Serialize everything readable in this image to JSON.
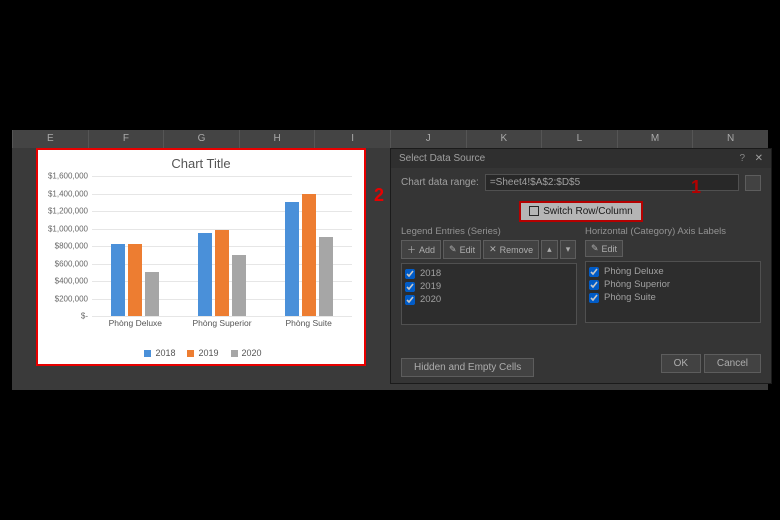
{
  "columns": [
    "E",
    "F",
    "G",
    "H",
    "I",
    "J",
    "K",
    "L",
    "M",
    "N"
  ],
  "dialog": {
    "title": "Select Data Source",
    "range_label": "Chart data range:",
    "range_value": "=Sheet4!$A$2:$D$5",
    "switch_label": "Switch Row/Column",
    "series_head": "Legend Entries (Series)",
    "axis_head": "Horizontal (Category) Axis Labels",
    "add_label": "Add",
    "edit_label": "Edit",
    "remove_label": "Remove",
    "edit2_label": "Edit",
    "series_items": [
      "2018",
      "2019",
      "2020"
    ],
    "axis_items": [
      "Phòng Deluxe",
      "Phòng Superior",
      "Phòng Suite"
    ],
    "hidden_label": "Hidden and Empty Cells",
    "ok_label": "OK",
    "cancel_label": "Cancel"
  },
  "callouts": {
    "one": "1",
    "two": "2"
  },
  "chart_data": {
    "type": "bar",
    "title": "Chart Title",
    "categories": [
      "Phòng Deluxe",
      "Phòng Superior",
      "Phòng Suite"
    ],
    "series": [
      {
        "name": "2018",
        "color": "#4a90d9",
        "values": [
          820000,
          950000,
          1300000
        ]
      },
      {
        "name": "2019",
        "color": "#ed7d31",
        "values": [
          820000,
          980000,
          1400000
        ]
      },
      {
        "name": "2020",
        "color": "#a6a6a6",
        "values": [
          500000,
          700000,
          900000
        ]
      }
    ],
    "ylim": [
      0,
      1600000
    ],
    "yticks": [
      "$1,600,000",
      "$1,400,000",
      "$1,200,000",
      "$1,000,000",
      "$800,000",
      "$600,000",
      "$400,000",
      "$200,000",
      "$-"
    ],
    "xlabel": "",
    "ylabel": ""
  }
}
